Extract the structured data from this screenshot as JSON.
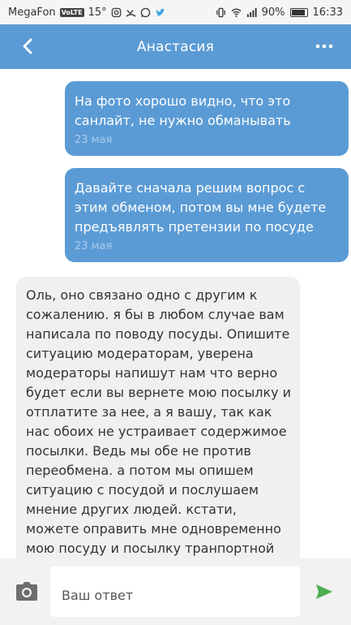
{
  "status_bar": {
    "carrier": "MegaFon",
    "badge": "VoLTE",
    "temperature": "15°",
    "battery": "90%",
    "time": "16:33"
  },
  "header": {
    "title": "Анастасия"
  },
  "messages": [
    {
      "direction": "out",
      "text": "На фото хорошо видно, что это санлайт, не нужно обманывать",
      "time": "23 мая"
    },
    {
      "direction": "out",
      "text": "Давайте сначала решим вопрос с этим обменом, потом вы мне будете предъявлять претензии по посуде",
      "time": "23 мая"
    },
    {
      "direction": "in",
      "text": "Оль, оно связано одно с другим к сожалению. я бы в любом случае вам написала по поводу посуды. Опишите ситуацию модераторам, уверена модераторы напишут нам что верно будет если вы вернете мою посылку и отплатите за нее, а я вашу, так как нас обоих не устраивает содержимое посылки. Ведь мы обе не против переобмена. а потом мы опишем ситуацию с посудой и послушаем мнение других людей. кстати, можете оправить мне одновременно мою посуду и посылку транпортной"
    }
  ],
  "composer": {
    "placeholder": "Ваш ответ",
    "value": ""
  },
  "colors": {
    "accent": "#5b9bd5",
    "send": "#4caf50"
  }
}
